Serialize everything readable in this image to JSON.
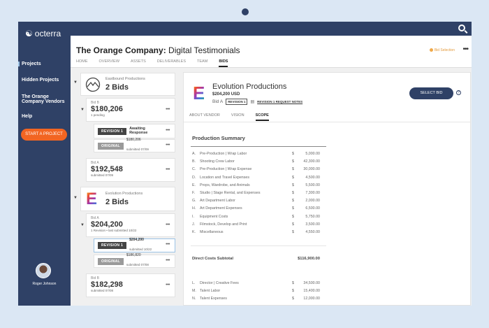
{
  "app": {
    "logo": "octerra",
    "search_icon": "search-icon"
  },
  "sidebar": {
    "items": [
      {
        "label": "Projects"
      },
      {
        "label": "Hidden Projects"
      },
      {
        "label": "The Orange Company Vendors"
      },
      {
        "label": "Help"
      }
    ],
    "start_button": "START A PROJECT",
    "user": "Roger Johnson"
  },
  "header": {
    "client": "The Orange Company:",
    "project": "Digital Testimonials",
    "status": "Bid Selection",
    "more": "•••",
    "tabs": [
      "HOME",
      "OVERVIEW",
      "ASSETS",
      "DELIVERABLES",
      "TEAM",
      "BIDS"
    ]
  },
  "vendors": [
    {
      "name": "Eastbound Productions",
      "count": "2 Bids",
      "bids": [
        {
          "label": "Bid B",
          "amount": "$180,206",
          "sub": "1 pending",
          "revisions": [
            {
              "tag": "REVISION 1",
              "text": "Awaiting Response",
              "sub": ""
            },
            {
              "tag": "ORIGINAL",
              "text": "$180,206",
              "sub": "submitted 07/09"
            }
          ]
        },
        {
          "label": "Bid A",
          "amount": "$192,548",
          "sub": "submitted 07/09"
        }
      ]
    },
    {
      "name": "Evolution Productions",
      "count": "2 Bids",
      "bids": [
        {
          "label": "Bid A",
          "amount": "$204,200",
          "sub": "1 Revision  •  last submitted 10/22",
          "revisions": [
            {
              "tag": "REVISION 1",
              "text": "$204,200",
              "sub": "submitted 10/22"
            },
            {
              "tag": "ORIGINAL",
              "text": "$186,820",
              "sub": "submitted 07/08"
            }
          ]
        },
        {
          "label": "Bid B",
          "amount": "$182,298",
          "sub": "submitted 07/08"
        }
      ]
    }
  ],
  "detail": {
    "vendor": "Evolution Productions",
    "amount": "$204,200 USD",
    "bid": "Bid A",
    "revision": "REVISION 1",
    "notes": "REVISION 1 REQUEST NOTES",
    "select": "SELECT BID",
    "help": "?",
    "tabs": [
      "ABOUT VENDOR",
      "VISION",
      "SCOPE"
    ],
    "summary_title": "Production Summary",
    "lines": [
      {
        "l": "A.",
        "n": "Pre-Production | Wrap Labor",
        "v": "5,000.00"
      },
      {
        "l": "B.",
        "n": "Shooting Crew Labor",
        "v": "42,300.00"
      },
      {
        "l": "C.",
        "n": "Pre-Production | Wrap Expense",
        "v": "30,000.00"
      },
      {
        "l": "D.",
        "n": "Location and Travel Expenses",
        "v": "4,500.00"
      },
      {
        "l": "E.",
        "n": "Props, Wardrobe, and Animals",
        "v": "5,500.00"
      },
      {
        "l": "F.",
        "n": "Studio | Stage Rental, and Expenses",
        "v": "7,300.00"
      },
      {
        "l": "G.",
        "n": "Art Department Labor",
        "v": "2,000.00"
      },
      {
        "l": "H.",
        "n": "Art Department Expenses",
        "v": "6,500.00"
      },
      {
        "l": "I.",
        "n": "Equipment Costs",
        "v": "5,750.00"
      },
      {
        "l": "J.",
        "n": "Filmstock, Develop and Print",
        "v": "3,500.00"
      },
      {
        "l": "K.",
        "n": "Miscellaneous",
        "v": "4,550.00"
      }
    ],
    "subtotal_label": "Direct Costs Subtotal",
    "subtotal": "$116,900.00",
    "lines2": [
      {
        "l": "L.",
        "n": "Director | Creative Fees",
        "v": "34,500.00"
      },
      {
        "l": "M.",
        "n": "Talent Labor",
        "v": "15,400.00"
      },
      {
        "l": "N.",
        "n": "Talent Expenses",
        "v": "12,000.00"
      }
    ],
    "currency": "$"
  }
}
